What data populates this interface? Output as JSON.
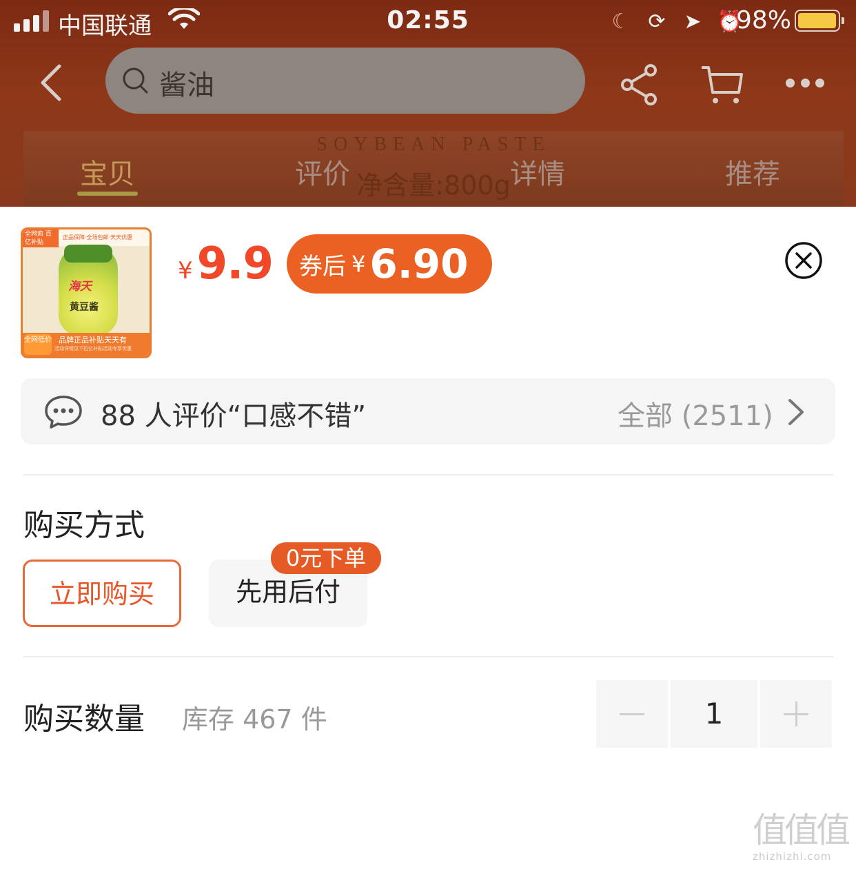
{
  "status_bar": {
    "carrier": "中国联通",
    "time": "02:55",
    "battery_pct": "98%",
    "battery_level": 0.98,
    "icons": [
      "moon-icon",
      "orientation-lock-icon",
      "location-arrow-icon",
      "alarm-icon"
    ]
  },
  "nav": {
    "search_query": "酱油",
    "icons": [
      "back-icon",
      "search-icon",
      "share-icon",
      "cart-icon",
      "more-icon"
    ]
  },
  "background": {
    "en_text": "SOYBEAN PASTE",
    "net_weight": "净含量:800g"
  },
  "tabs": [
    {
      "label": "宝贝",
      "active": true
    },
    {
      "label": "评价",
      "active": false
    },
    {
      "label": "详情",
      "active": false
    },
    {
      "label": "推荐",
      "active": false
    }
  ],
  "product": {
    "thumb": {
      "badge": "全网疯 百亿补贴",
      "slogan": "正品保障·全场包邮·天天优惠",
      "brand": "海天",
      "name": "黄豆酱",
      "footer": "品牌正品补贴天天有",
      "footer_small": "活动详情见下拉亿补贴活动专享优惠",
      "low_price": "全网低价"
    },
    "currency": "¥",
    "price": "9.9",
    "coupon_label": "券后",
    "coupon_currency": "¥",
    "coupon_price": "6.90"
  },
  "review": {
    "summary": "88 人评价“口感不错”",
    "all_label": "全部 (2511)"
  },
  "purchase_method": {
    "title": "购买方式",
    "options": [
      {
        "label": "立即购买",
        "selected": true
      },
      {
        "label": "先用后付",
        "selected": false,
        "badge": "0元下单"
      }
    ]
  },
  "quantity": {
    "title": "购买数量",
    "stock": "库存 467 件",
    "value": "1"
  },
  "watermark": {
    "chars": "值值值",
    "url": "zhizhizhi.com"
  },
  "colors": {
    "accent": "#eb6124",
    "price": "#f2482a",
    "header_bg": "#7c2a12"
  }
}
